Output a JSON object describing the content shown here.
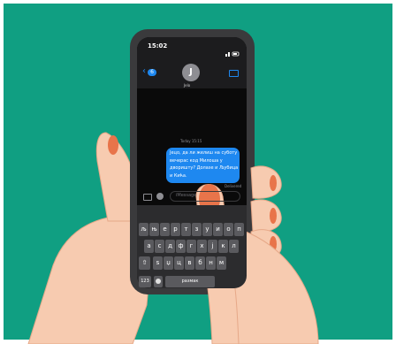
{
  "colors": {
    "background": "#109f82",
    "phone_body": "#3a3a3c",
    "screen": "#0a0a0a",
    "bubble": "#1e88f0",
    "skin": "#f7cbb0",
    "skin_shadow": "#e8a98c",
    "nail": "#e8744a"
  },
  "status_bar": {
    "time": "15:02"
  },
  "header": {
    "back_count": "6",
    "avatar_initial": "J",
    "contact_name": "Jelo"
  },
  "conversation": {
    "timestamp": "Today 15:15",
    "message": "Јецо, да ли желиш на суботу вечерас код Милоша у дворишту? Долазе и Љубица и Кића.",
    "message_lines": [
      "Јецо, да ли желиш на суботу",
      "вечерас код Милоша у",
      "дворишту? Долазе и Љубица",
      "и Кића."
    ],
    "status": "Delivered"
  },
  "input_bar": {
    "placeholder": "iMessage"
  },
  "keyboard": {
    "row1": [
      "љ",
      "њ",
      "е",
      "р",
      "т",
      "з",
      "у",
      "и",
      "о",
      "п"
    ],
    "row2": [
      "а",
      "с",
      "д",
      "ф",
      "г",
      "х",
      "ј",
      "к",
      "л"
    ],
    "row3": [
      "ѕ",
      "џ",
      "ц",
      "в",
      "б",
      "н",
      "м"
    ],
    "numbers_key": "123",
    "space_label": "размак"
  }
}
